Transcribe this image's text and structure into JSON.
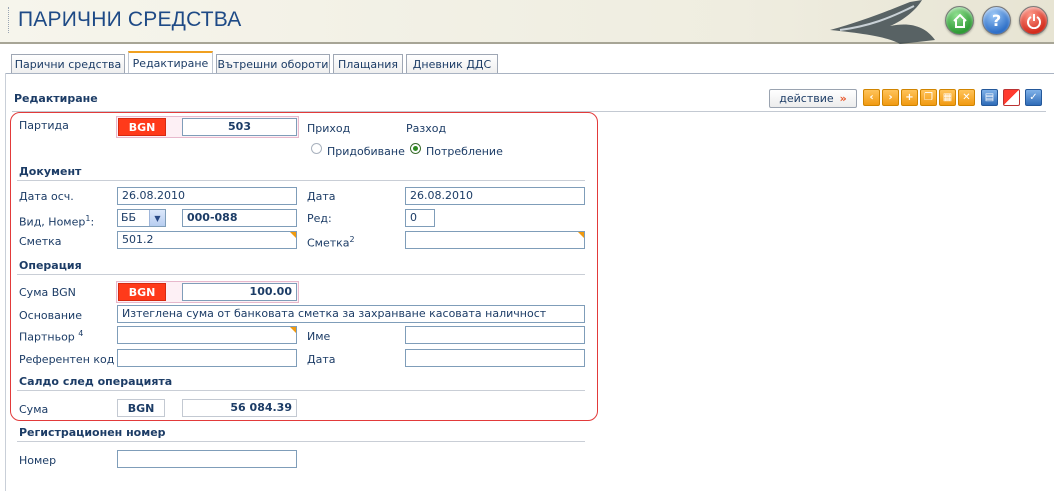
{
  "app": {
    "title": "ПАРИЧНИ СРЕДСТВА"
  },
  "header_buttons": [
    {
      "name": "home-icon"
    },
    {
      "name": "help-icon",
      "glyph": "?"
    },
    {
      "name": "power-icon"
    }
  ],
  "tabs": [
    {
      "label": "Парични средства"
    },
    {
      "label": "Редактиране",
      "active": true
    },
    {
      "label": "Вътрешни обороти"
    },
    {
      "label": "Плащания"
    },
    {
      "label": "Дневник ДДС"
    }
  ],
  "panel": {
    "title": "Редактиране"
  },
  "toolbar": {
    "action_label": "действие",
    "action_arrow": "»"
  },
  "partida": {
    "label": "Партида",
    "currency": "BGN",
    "number": "503",
    "income_label": "Приход",
    "expense_label": "Разход",
    "radio_acquire": "Придобиване",
    "radio_consume": "Потребление"
  },
  "document": {
    "section": "Документ",
    "date_acc_label": "Дата осч.",
    "date_acc_value": "26.08.2010",
    "date_label": "Дата",
    "date_value": "26.08.2010",
    "type_label": "Вид, Номер",
    "type_sup": "1",
    "type_value": "ББ",
    "number_value": "000-088",
    "row_label": "Ред:",
    "row_value": "0",
    "account_label": "Сметка",
    "account_value": "501.2",
    "account2_label": "Сметка",
    "account2_sup": "2",
    "account2_value": ""
  },
  "operation": {
    "section": "Операция",
    "amount_label": "Сума BGN",
    "currency": "BGN",
    "amount_value": "100.00",
    "basis_label": "Основание",
    "basis_value": "Изтеглена сума от банковата сметка за захранване касовата наличност",
    "partner_label": "Партньор",
    "partner_sup": "4",
    "partner_value": "",
    "name_label": "Име",
    "name_value": "",
    "ref_label": "Референтен код",
    "ref_value": "",
    "date_label": "Дата",
    "date_value": ""
  },
  "balance": {
    "section": "Салдо след операцията",
    "sum_label": "Сума",
    "currency": "BGN",
    "sum_value": "56 084.39"
  },
  "registration": {
    "section": "Регистрационен номер",
    "number_label": "Номер",
    "number_value": ""
  },
  "colors": {
    "accent_red": "#ff3a1a",
    "title_blue": "#1e4a86",
    "toolbar_orange": "#f19a12",
    "highlight_border": "#e23a3a"
  }
}
